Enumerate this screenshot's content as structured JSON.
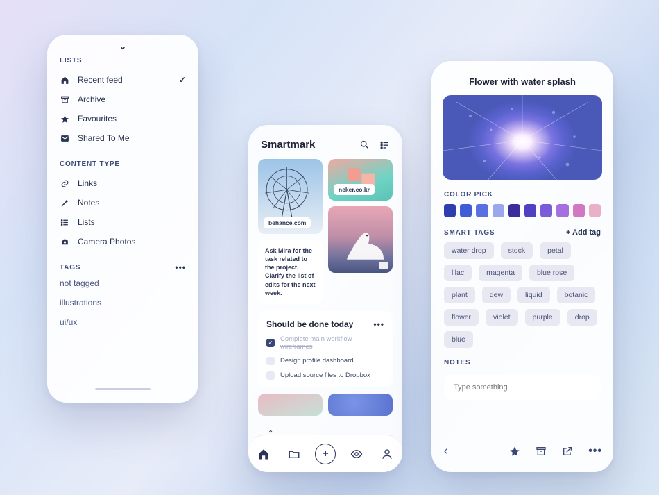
{
  "left_panel": {
    "sections": {
      "lists": {
        "title": "LISTS",
        "items": [
          {
            "icon": "home",
            "label": "Recent feed",
            "selected": true
          },
          {
            "icon": "archive",
            "label": "Archive"
          },
          {
            "icon": "star",
            "label": "Favourites"
          },
          {
            "icon": "mail",
            "label": "Shared To Me"
          }
        ]
      },
      "content_type": {
        "title": "CONTENT TYPE",
        "items": [
          {
            "icon": "link",
            "label": "Links"
          },
          {
            "icon": "pencil",
            "label": "Notes"
          },
          {
            "icon": "list",
            "label": "Lists"
          },
          {
            "icon": "camera",
            "label": "Camera Photos"
          }
        ]
      },
      "tags": {
        "title": "TAGS",
        "items": [
          "not tagged",
          "illustrations",
          "ui/ux"
        ]
      }
    }
  },
  "feed": {
    "app_name": "Smartmark",
    "cards": {
      "behance_badge": "behance.com",
      "neker_badge": "neker.co.kr"
    },
    "note_text": "Ask Mira for the task related to the project. Clarify the list of edits for the next week.",
    "todo": {
      "title": "Should be done today",
      "tasks": [
        {
          "label": "Complete main workflow wireframes",
          "done": true
        },
        {
          "label": "Design profile dashboard",
          "done": false
        },
        {
          "label": "Upload source files to Dropbox",
          "done": false
        }
      ]
    }
  },
  "detail": {
    "title": "Flower with water splash",
    "color_pick_title": "COLOR PICK",
    "swatches": [
      "#2d3fae",
      "#3f5bd6",
      "#5a6fe0",
      "#9aa7ec",
      "#3a2c9a",
      "#5240c4",
      "#7a5bd8",
      "#a56fe0",
      "#d278c3",
      "#e9b0c8"
    ],
    "smart_tags_title": "SMART TAGS",
    "add_tag_label": "+ Add tag",
    "tags": [
      "water drop",
      "stock",
      "petal",
      "lilac",
      "magenta",
      "blue rose",
      "plant",
      "dew",
      "liquid",
      "botanic",
      "flower",
      "violet",
      "purple",
      "drop",
      "blue"
    ],
    "notes_title": "NOTES",
    "notes_placeholder": "Type something"
  }
}
